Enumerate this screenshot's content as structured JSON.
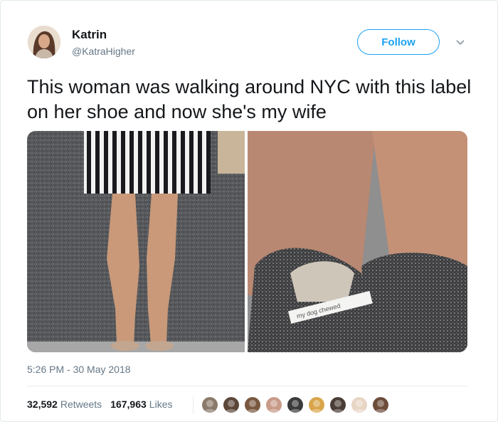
{
  "author": {
    "name": "Katrin",
    "handle": "@KatraHigher",
    "avatar_icon": "profile-photo"
  },
  "follow_label": "Follow",
  "tweet_text": "This woman was walking around NYC with this label on her shoe and now she's my wife",
  "media": {
    "left_photo": "legs-in-striped-skirt",
    "right_photo": "shoes-heel-label",
    "label_text": "my dog chewed"
  },
  "timestamp": "5:26 PM - 30 May 2018",
  "stats": {
    "retweets_count": "32,592",
    "retweets_label": "Retweets",
    "likes_count": "167,963",
    "likes_label": "Likes"
  },
  "likers": [
    {
      "icon": "liker-avatar",
      "color": "#8a7a6a"
    },
    {
      "icon": "liker-avatar",
      "color": "#5c4638"
    },
    {
      "icon": "liker-avatar",
      "color": "#7a5840"
    },
    {
      "icon": "liker-avatar",
      "color": "#c89a88"
    },
    {
      "icon": "liker-avatar",
      "color": "#3a3a3a"
    },
    {
      "icon": "liker-avatar",
      "color": "#d9a54a"
    },
    {
      "icon": "liker-avatar",
      "color": "#4a3c36"
    },
    {
      "icon": "liker-avatar",
      "color": "#e8d6c4"
    },
    {
      "icon": "liker-avatar",
      "color": "#6d4c3a"
    }
  ],
  "colors": {
    "accent": "#1da1f2",
    "text": "#14171a",
    "muted": "#657786"
  }
}
